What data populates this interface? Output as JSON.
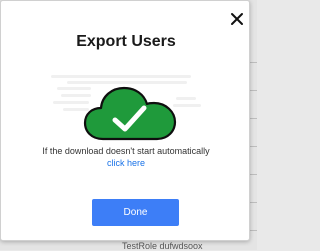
{
  "dialog": {
    "title": "Export Users",
    "message": "If the download doesn't start automatically",
    "link_text": "click here",
    "done_label": "Done"
  },
  "background": {
    "partial_text": "TestRole dufwdsoox"
  },
  "icons": {
    "close": "close-icon",
    "cloud": "cloud-check-icon"
  },
  "colors": {
    "cloud_fill": "#1f9a3b",
    "cloud_stroke": "#0f0f0f",
    "button": "#3d7ef7",
    "link": "#1a73e8"
  }
}
